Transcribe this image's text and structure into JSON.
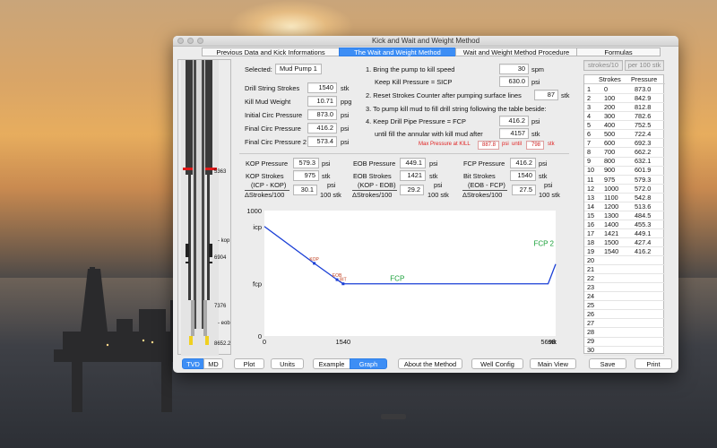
{
  "window": {
    "title": "Kick and Wait and Weight Method"
  },
  "tabs": [
    {
      "label": "Previous Data and Kick Informations"
    },
    {
      "label": "The Wait and Weight Method"
    },
    {
      "label": "Wait and Weight Method Procedure"
    },
    {
      "label": "Formulas"
    }
  ],
  "well": {
    "depth_labels": [
      "5363",
      "- kop",
      "6904",
      "7376",
      "- eob",
      "8652.2"
    ]
  },
  "inputs": {
    "selected_label": "Selected:",
    "selected_value": "Mud Pump 1",
    "drill_string_strokes": {
      "label": "Drill String Strokes",
      "value": "1540",
      "unit": "stk"
    },
    "kill_mud_weight": {
      "label": "Kill Mud Weight",
      "value": "10.71",
      "unit": "ppg"
    },
    "initial_circ_pressure": {
      "label": "Initial Circ Pressure",
      "value": "873.0",
      "unit": "psi"
    },
    "final_circ_pressure": {
      "label": "Final Circ Pressure",
      "value": "416.2",
      "unit": "psi"
    },
    "final_circ_pressure_2": {
      "label": "Final Circ Pressure 2",
      "value": "573.4",
      "unit": "psi"
    }
  },
  "procedure": {
    "step1": {
      "label": "1. Bring the pump to kill speed",
      "value": "30",
      "unit": "spm"
    },
    "step1b": {
      "label": "Keep Kill Pressure = SICP",
      "value": "630.0",
      "unit": "psi"
    },
    "step2": {
      "label": "2. Reset Strokes Counter after pumping surface lines",
      "value": "87",
      "unit": "stk"
    },
    "step3": {
      "label": "3. To pump kill mud to fill drill string following the table beside:"
    },
    "step4": {
      "label": "4. Keep Drill Pipe Pressure = FCP",
      "value": "416.2",
      "unit": "psi"
    },
    "step4b": {
      "label": "until fill the annular with kill mud after",
      "value": "4157",
      "unit": "stk"
    },
    "max_pressure": {
      "label": "Max Pressure at KILL",
      "value": "887.8",
      "unit1": "psi",
      "until": "until",
      "value2": "798",
      "unit2": "stk"
    }
  },
  "sections": {
    "kop": {
      "pressure_label": "KOP Pressure",
      "pressure_value": "579.3",
      "pressure_unit": "psi",
      "strokes_label": "KOP Strokes",
      "strokes_value": "975",
      "strokes_unit": "stk",
      "ratio_top": "(ICP - KOP)",
      "ratio_bottom": "ΔStrokes/100",
      "ratio_value": "30.1",
      "ratio_unit_top": "psi",
      "ratio_unit_bottom": "100 stk"
    },
    "eob": {
      "pressure_label": "EOB Pressure",
      "pressure_value": "449.1",
      "pressure_unit": "psi",
      "strokes_label": "EOB Strokes",
      "strokes_value": "1421",
      "strokes_unit": "stk",
      "ratio_top": "(KOP - EOB)",
      "ratio_bottom": "ΔStrokes/100",
      "ratio_value": "29.2",
      "ratio_unit_top": "psi",
      "ratio_unit_bottom": "100 stk"
    },
    "fcp": {
      "pressure_label": "FCP Pressure",
      "pressure_value": "416.2",
      "pressure_unit": "psi",
      "strokes_label": "Bit Strokes",
      "strokes_value": "1540",
      "strokes_unit": "stk",
      "ratio_top": "(EOB - FCP)",
      "ratio_bottom": "ΔStrokes/100",
      "ratio_value": "27.5",
      "ratio_unit_top": "psi",
      "ratio_unit_bottom": "100 stk"
    }
  },
  "chart_data": {
    "type": "line",
    "y_tick_labels": [
      "1000",
      "icp",
      "fcp",
      "0"
    ],
    "x_tick_labels": [
      "0",
      "1540",
      "5698"
    ],
    "xlabel": "stk",
    "xlim": [
      0,
      5698
    ],
    "ylim": [
      0,
      1000
    ],
    "series": [
      {
        "name": "FCP",
        "x": [
          0,
          975,
          1421,
          1540,
          5550,
          5698
        ],
        "y": [
          873.0,
          579.3,
          449.1,
          416.2,
          416.2,
          573.4
        ]
      }
    ],
    "point_labels": [
      {
        "text": "KOP",
        "x": 975,
        "y": 579.3
      },
      {
        "text": "EOB",
        "x": 1421,
        "y": 449.1
      },
      {
        "text": "BIT",
        "x": 1540,
        "y": 416.2
      }
    ],
    "annotations": [
      {
        "text": "FCP",
        "x": 2600,
        "y": 416.2
      },
      {
        "text": "FCP 2",
        "x": 5698,
        "y": 573.4
      }
    ],
    "colors": {
      "line": "#1a3fd6",
      "annotation": "#18a038"
    }
  },
  "strokes_table": {
    "toggle_left": "strokes/10",
    "toggle_right": "per 100 stk",
    "headers": [
      "Strokes",
      "Pressure"
    ],
    "rows": [
      {
        "n": "1",
        "s": "0",
        "p": "873.0"
      },
      {
        "n": "2",
        "s": "100",
        "p": "842.9"
      },
      {
        "n": "3",
        "s": "200",
        "p": "812.8"
      },
      {
        "n": "4",
        "s": "300",
        "p": "782.6"
      },
      {
        "n": "5",
        "s": "400",
        "p": "752.5"
      },
      {
        "n": "6",
        "s": "500",
        "p": "722.4"
      },
      {
        "n": "7",
        "s": "600",
        "p": "692.3"
      },
      {
        "n": "8",
        "s": "700",
        "p": "662.2"
      },
      {
        "n": "9",
        "s": "800",
        "p": "632.1"
      },
      {
        "n": "10",
        "s": "900",
        "p": "601.9"
      },
      {
        "n": "11",
        "s": "975",
        "p": "579.3"
      },
      {
        "n": "12",
        "s": "1000",
        "p": "572.0"
      },
      {
        "n": "13",
        "s": "1100",
        "p": "542.8"
      },
      {
        "n": "14",
        "s": "1200",
        "p": "513.6"
      },
      {
        "n": "15",
        "s": "1300",
        "p": "484.5"
      },
      {
        "n": "16",
        "s": "1400",
        "p": "455.3"
      },
      {
        "n": "17",
        "s": "1421",
        "p": "449.1"
      },
      {
        "n": "18",
        "s": "1500",
        "p": "427.4"
      },
      {
        "n": "19",
        "s": "1540",
        "p": "416.2"
      },
      {
        "n": "20",
        "s": "",
        "p": ""
      },
      {
        "n": "21",
        "s": "",
        "p": ""
      },
      {
        "n": "22",
        "s": "",
        "p": ""
      },
      {
        "n": "23",
        "s": "",
        "p": ""
      },
      {
        "n": "24",
        "s": "",
        "p": ""
      },
      {
        "n": "25",
        "s": "",
        "p": ""
      },
      {
        "n": "26",
        "s": "",
        "p": ""
      },
      {
        "n": "27",
        "s": "",
        "p": ""
      },
      {
        "n": "28",
        "s": "",
        "p": ""
      },
      {
        "n": "29",
        "s": "",
        "p": ""
      },
      {
        "n": "30",
        "s": "",
        "p": ""
      }
    ]
  },
  "bottom_bar": {
    "tvd": "TVD",
    "md": "MD",
    "plot": "Plot",
    "units": "Units",
    "example": "Example",
    "graph": "Graph",
    "about": "About the Method",
    "well_config": "Well Config",
    "main_view": "Main View",
    "save": "Save",
    "print": "Print"
  }
}
